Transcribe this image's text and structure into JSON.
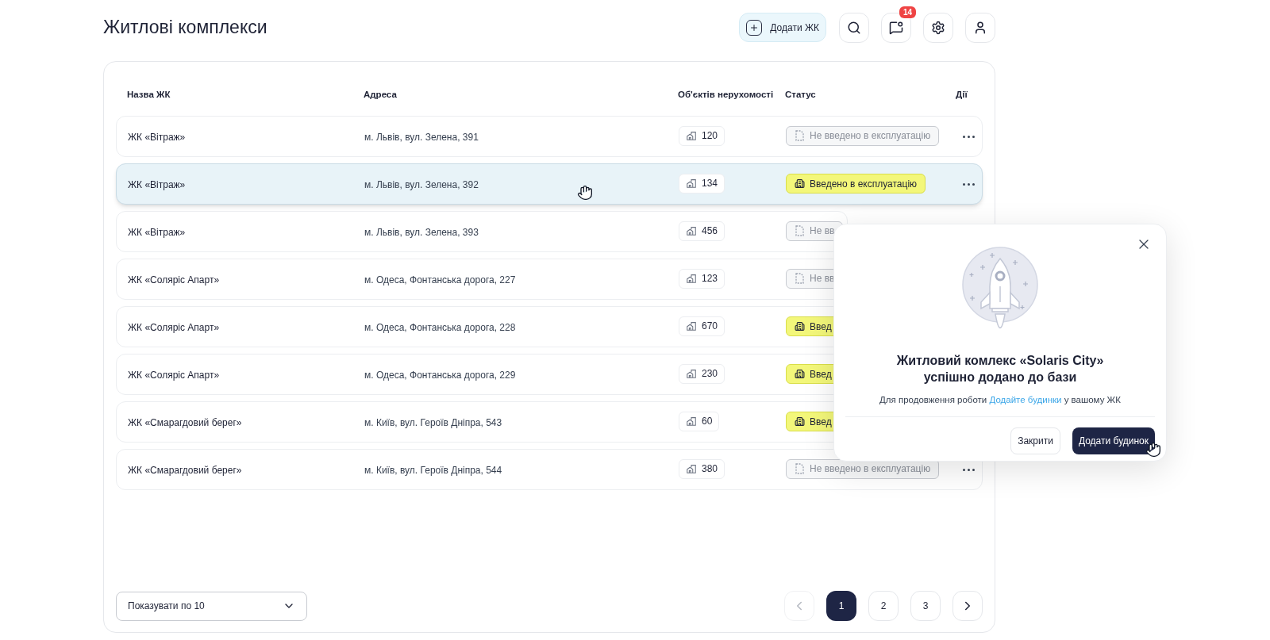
{
  "page_title": "Житлові комплекси",
  "toolbar": {
    "add_button": "Додати ЖК",
    "notifications_badge": "14"
  },
  "table": {
    "columns": [
      "Назва ЖК",
      "Адреса",
      "Об'єктів нерухомості",
      "Статус",
      "Дії"
    ],
    "rows": [
      {
        "name": "ЖК «Вітраж»",
        "address": "м. Львів, вул. Зелена, 391",
        "objects": "120",
        "status": "Не введено в експлуатацію",
        "commissioned": false,
        "selected": false,
        "menu": true
      },
      {
        "name": "ЖК «Вітраж»",
        "address": "м. Львів, вул. Зелена, 392",
        "objects": "134",
        "status": "Введено в експлуатацію",
        "commissioned": true,
        "selected": true,
        "menu": true
      },
      {
        "name": "ЖК «Вітраж»",
        "address": "м. Львів, вул. Зелена, 393",
        "objects": "456",
        "status": "Не вв",
        "commissioned": false,
        "selected": false,
        "menu": false
      },
      {
        "name": "ЖК «Соляріс Апарт»",
        "address": "м. Одеса, Фонтанська дорога, 227",
        "objects": "123",
        "status": "Не вв",
        "commissioned": false,
        "selected": false,
        "menu": false
      },
      {
        "name": "ЖК «Соляріс Апарт»",
        "address": "м. Одеса, Фонтанська дорога, 228",
        "objects": "670",
        "status": "Введ",
        "commissioned": true,
        "selected": false,
        "menu": false
      },
      {
        "name": "ЖК «Соляріс Апарт»",
        "address": "м. Одеса, Фонтанська дорога, 229",
        "objects": "230",
        "status": "Введ",
        "commissioned": true,
        "selected": false,
        "menu": false
      },
      {
        "name": "ЖК «Смарагдовий берег»",
        "address": "м. Київ, вул. Героїв Дніпра, 543",
        "objects": "60",
        "status": "Введ",
        "commissioned": true,
        "selected": false,
        "menu": false
      },
      {
        "name": "ЖК «Смарагдовий берег»",
        "address": "м. Київ, вул. Героїв Дніпра, 544",
        "objects": "380",
        "status": "Не введено в експлуатацію",
        "commissioned": false,
        "selected": false,
        "menu": true
      }
    ]
  },
  "page_size": {
    "value": "Показувати по 10"
  },
  "pagination": {
    "pages": [
      {
        "label": "1",
        "selected": true
      },
      {
        "label": "2",
        "selected": false
      },
      {
        "label": "3",
        "selected": false
      }
    ]
  },
  "dialog": {
    "title_line_1": "Житловий комлекс «Solaris City»",
    "title_line_2": "успішно додано до бази",
    "text_before": "Для продовження роботи",
    "link": "Додайте будинки",
    "text_after": "у вашому ЖК",
    "close_button": "Закрити",
    "primary_button": "Додати будинок"
  }
}
